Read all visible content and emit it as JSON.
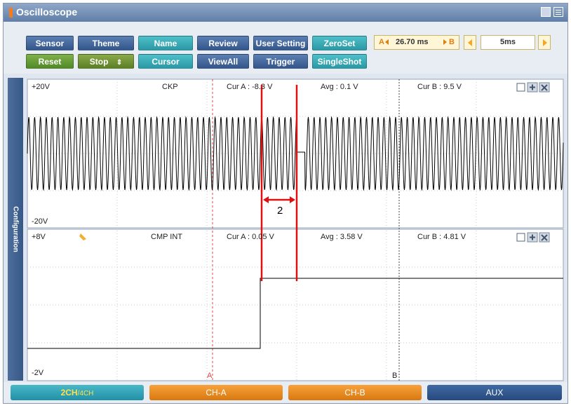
{
  "window": {
    "title": "Oscilloscope"
  },
  "toolbar": {
    "row1": [
      "Sensor",
      "Theme",
      "Name",
      "Review",
      "User Setting",
      "ZeroSet"
    ],
    "row2": [
      "Reset",
      "Stop",
      "Cursor",
      "ViewAll",
      "Trigger",
      "SingleShot"
    ],
    "stop_arrows": "⇕",
    "cursor_readout": {
      "a_label": "A",
      "value": "26.70 ms",
      "b_label": "B"
    },
    "timebase": "5ms"
  },
  "sidebar": {
    "label": "Configuration"
  },
  "channels": [
    {
      "name": "CKP",
      "vmax": "+20V",
      "vmin": "-20V",
      "cur_a": "Cur A : -8.3 V",
      "avg": "Avg : 0.1 V",
      "cur_b": "Cur B : 9.5 V"
    },
    {
      "name": "CMP INT",
      "vmax": "+8V",
      "vmin": "-2V",
      "cur_a": "Cur A : 0.05 V",
      "avg": "Avg : 3.58 V",
      "cur_b": "Cur B : 4.81 V"
    }
  ],
  "annotation": {
    "label": "2"
  },
  "markers": {
    "a": "A",
    "b": "B"
  },
  "bottom": {
    "ch_mode_main": "2CH",
    "ch_mode_sub": "/4CH",
    "ch_a": "CH-A",
    "ch_b": "CH-B",
    "aux": "AUX"
  },
  "colors": {
    "annotation": "#e01010",
    "trace": "#000000",
    "accent": "#f47b20"
  }
}
